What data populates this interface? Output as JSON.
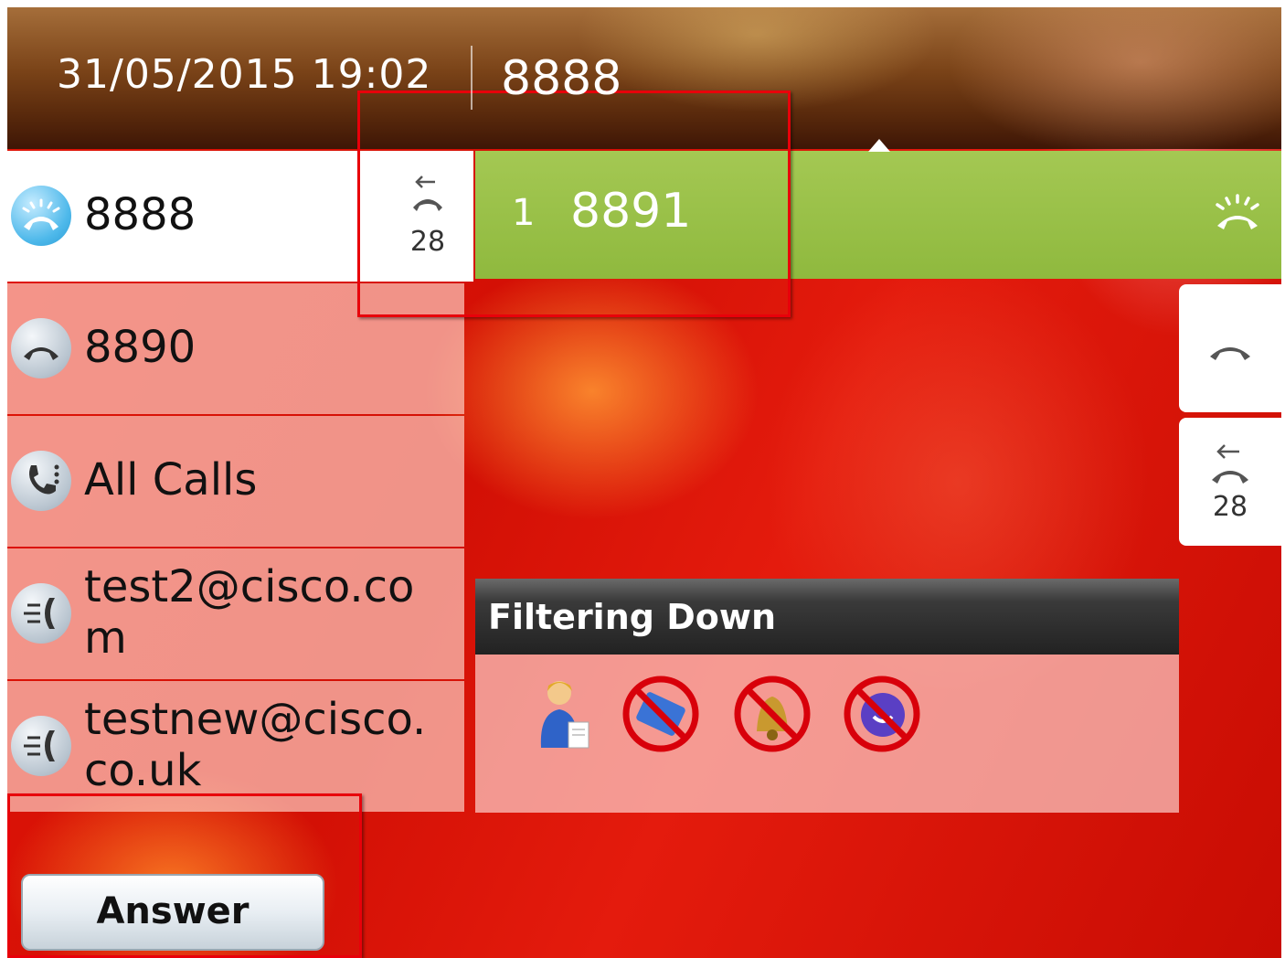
{
  "header": {
    "datetime": "31/05/2015 19:02",
    "line_number": "8888"
  },
  "lines": [
    {
      "label": "8888",
      "icon": "ringing-phone-icon",
      "badge_count": "28",
      "state": "active"
    },
    {
      "label": "8890",
      "icon": "phone-icon"
    },
    {
      "label": "All Calls",
      "icon": "all-calls-icon"
    },
    {
      "label": "test2@cisco.co\nm",
      "icon": "intercom-icon"
    },
    {
      "label": "testnew@cisco.\nco.uk",
      "icon": "intercom-icon"
    }
  ],
  "session": {
    "index": "1",
    "number": "8891",
    "icon": "ringing-phone-icon",
    "color": "#9bc24a"
  },
  "side_buttons": [
    {
      "icon": "phone-icon"
    },
    {
      "icon": "missed-call-icon",
      "count": "28"
    }
  ],
  "filter_panel": {
    "title": "Filtering Down",
    "icons": [
      "receptionist-icon",
      "no-fax-icon",
      "no-bell-icon",
      "no-voicemail-icon"
    ]
  },
  "softkeys": {
    "answer": "Answer"
  },
  "colors": {
    "background": "#d91206",
    "session_green": "#9bc24a",
    "highlight_red": "#e8000a"
  }
}
